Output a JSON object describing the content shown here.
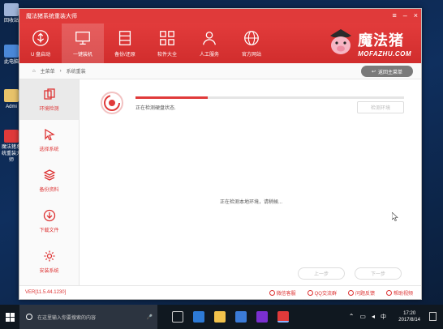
{
  "desktop": {
    "icons": [
      {
        "label": "回收站",
        "color": "#9fb4d8"
      },
      {
        "label": "此电脑",
        "color": "#4a88d8"
      },
      {
        "label": "Admi",
        "color": "#e8c36a"
      },
      {
        "label": "魔法猪系统重装大师",
        "color": "#e03a3a"
      }
    ]
  },
  "window": {
    "title": "魔法猪系统重装大师",
    "controls": [
      "≡",
      "–",
      "×"
    ]
  },
  "topnav": {
    "items": [
      {
        "label": "U 盘启动",
        "icon": "usb-icon",
        "active": false
      },
      {
        "label": "一键装机",
        "icon": "monitor-icon",
        "active": true
      },
      {
        "label": "备份/还原",
        "icon": "database-icon",
        "active": false
      },
      {
        "label": "软件大全",
        "icon": "apps-icon",
        "active": false
      },
      {
        "label": "人工服务",
        "icon": "person-icon",
        "active": false
      },
      {
        "label": "官方网站",
        "icon": "globe-icon",
        "active": false
      }
    ],
    "logo_main": "魔法猪",
    "logo_sub": "MOFAZHU.COM"
  },
  "breadcrumb": {
    "home": "主菜单",
    "current": "系统重装",
    "back_label": "返回主菜单"
  },
  "sidebar": {
    "items": [
      {
        "label": "环境检测",
        "icon": "copy-icon",
        "active": true
      },
      {
        "label": "选择系统",
        "icon": "cursor-icon",
        "active": false
      },
      {
        "label": "备份资料",
        "icon": "layers-icon",
        "active": false
      },
      {
        "label": "下载文件",
        "icon": "download-icon",
        "active": false
      },
      {
        "label": "安装系统",
        "icon": "gear-icon",
        "active": false
      }
    ]
  },
  "main": {
    "progress_fraction": 0.27,
    "status_text": "正在检测硬盘状态.",
    "redetect_label": "检测环境",
    "center_message": "正在检测本地环境，请稍候...",
    "prev_label": "上一步",
    "next_label": "下一步"
  },
  "footer": {
    "version": "VER[11.5.44.1230]",
    "links": [
      "微信客服",
      "QQ交流群",
      "问题反馈",
      "帮助视频"
    ]
  },
  "taskbar": {
    "search_placeholder": "在这里输入你要搜索的内容",
    "time": "17:20",
    "date": "2017/8/14"
  },
  "colors": {
    "brand_red": "#e03a3a",
    "taskbar": "#101820"
  }
}
